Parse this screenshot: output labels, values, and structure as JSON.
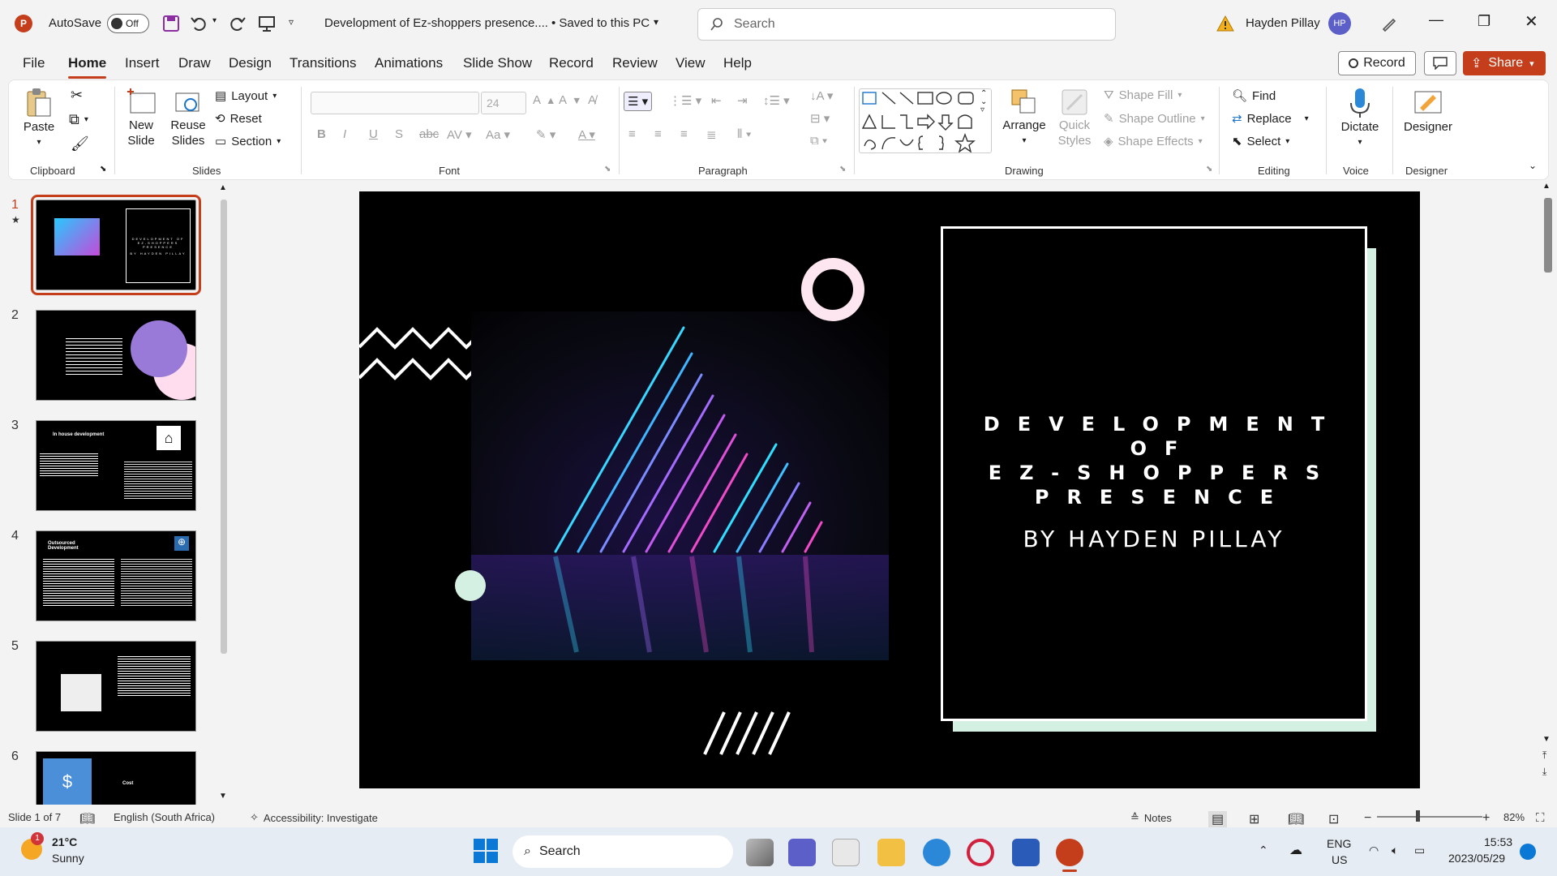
{
  "titlebar": {
    "autosave_label": "AutoSave",
    "autosave_state": "Off",
    "doc_title": "Development of Ez-shoppers presence....",
    "save_status": "• Saved to this PC",
    "search_placeholder": "Search",
    "user_name": "Hayden Pillay",
    "user_initials": "HP"
  },
  "menu": {
    "tabs": [
      "File",
      "Home",
      "Insert",
      "Draw",
      "Design",
      "Transitions",
      "Animations",
      "Slide Show",
      "Record",
      "Review",
      "View",
      "Help"
    ],
    "active_tab": "Home",
    "record_label": "Record",
    "share_label": "Share"
  },
  "ribbon": {
    "clipboard": {
      "paste": "Paste",
      "label": "Clipboard"
    },
    "slides": {
      "new_slide": "New Slide",
      "reuse_slides": "Reuse Slides",
      "layout": "Layout",
      "reset": "Reset",
      "section": "Section",
      "label": "Slides"
    },
    "font": {
      "size": "24",
      "label": "Font"
    },
    "paragraph": {
      "label": "Paragraph"
    },
    "drawing": {
      "arrange": "Arrange",
      "quick_styles": "Quick Styles",
      "shape_fill": "Shape Fill",
      "shape_outline": "Shape Outline",
      "shape_effects": "Shape Effects",
      "label": "Drawing"
    },
    "editing": {
      "find": "Find",
      "replace": "Replace",
      "select": "Select",
      "label": "Editing"
    },
    "voice": {
      "dictate": "Dictate",
      "label": "Voice"
    },
    "designer": {
      "designer": "Designer",
      "label": "Designer"
    }
  },
  "thumbnails": [
    {
      "num": "1",
      "title": "DEVELOPMENT OF EZ-SHOPPERS PRESENCE",
      "subtitle": "BY HAYDEN PILLAY"
    },
    {
      "num": "2"
    },
    {
      "num": "3",
      "title": "In house development"
    },
    {
      "num": "4",
      "title": "Outsourced Development"
    },
    {
      "num": "5"
    },
    {
      "num": "6",
      "title": "Cost"
    }
  ],
  "slide": {
    "title_lines": [
      "DEVELOPMENT",
      "OF",
      "EZ-SHOPPERS",
      "PRESENCE"
    ],
    "subtitle": "BY HAYDEN PILLAY",
    "accent_color": "#d4f0e2"
  },
  "status": {
    "slide_count": "Slide 1 of 7",
    "language": "English (South Africa)",
    "accessibility": "Accessibility: Investigate",
    "notes": "Notes",
    "zoom": "82%"
  },
  "taskbar": {
    "temperature": "21°C",
    "condition": "Sunny",
    "weather_badge": "1",
    "search_label": "Search",
    "lang_line1": "ENG",
    "lang_line2": "US",
    "time": "15:53",
    "date": "2023/05/29"
  }
}
